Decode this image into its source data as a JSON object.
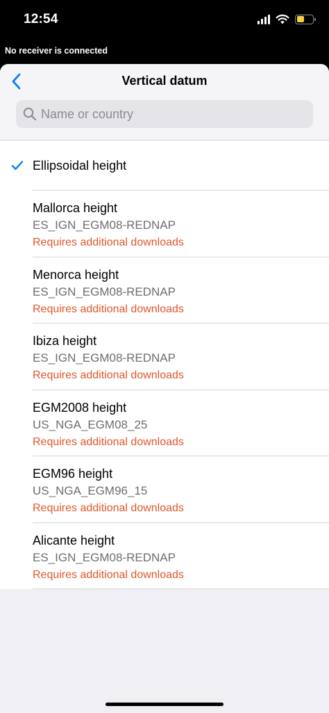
{
  "status_bar": {
    "time": "12:54",
    "battery_color": "#f7ce46"
  },
  "banner": {
    "text": "No receiver is connected"
  },
  "header": {
    "title": "Vertical datum"
  },
  "search": {
    "placeholder": "Name or country",
    "value": ""
  },
  "colors": {
    "accent": "#007aff",
    "warning": "#e0572b"
  },
  "selected_item": {
    "label": "Ellipsoidal height"
  },
  "items": [
    {
      "title": "Mallorca height",
      "subtitle": "ES_IGN_EGM08-REDNAP",
      "note": "Requires additional downloads"
    },
    {
      "title": "Menorca height",
      "subtitle": "ES_IGN_EGM08-REDNAP",
      "note": "Requires additional downloads"
    },
    {
      "title": "Ibiza height",
      "subtitle": "ES_IGN_EGM08-REDNAP",
      "note": "Requires additional downloads"
    },
    {
      "title": "EGM2008 height",
      "subtitle": "US_NGA_EGM08_25",
      "note": "Requires additional downloads"
    },
    {
      "title": "EGM96 height",
      "subtitle": "US_NGA_EGM96_15",
      "note": "Requires additional downloads"
    },
    {
      "title": "Alicante height",
      "subtitle": "ES_IGN_EGM08-REDNAP",
      "note": "Requires additional downloads"
    }
  ]
}
